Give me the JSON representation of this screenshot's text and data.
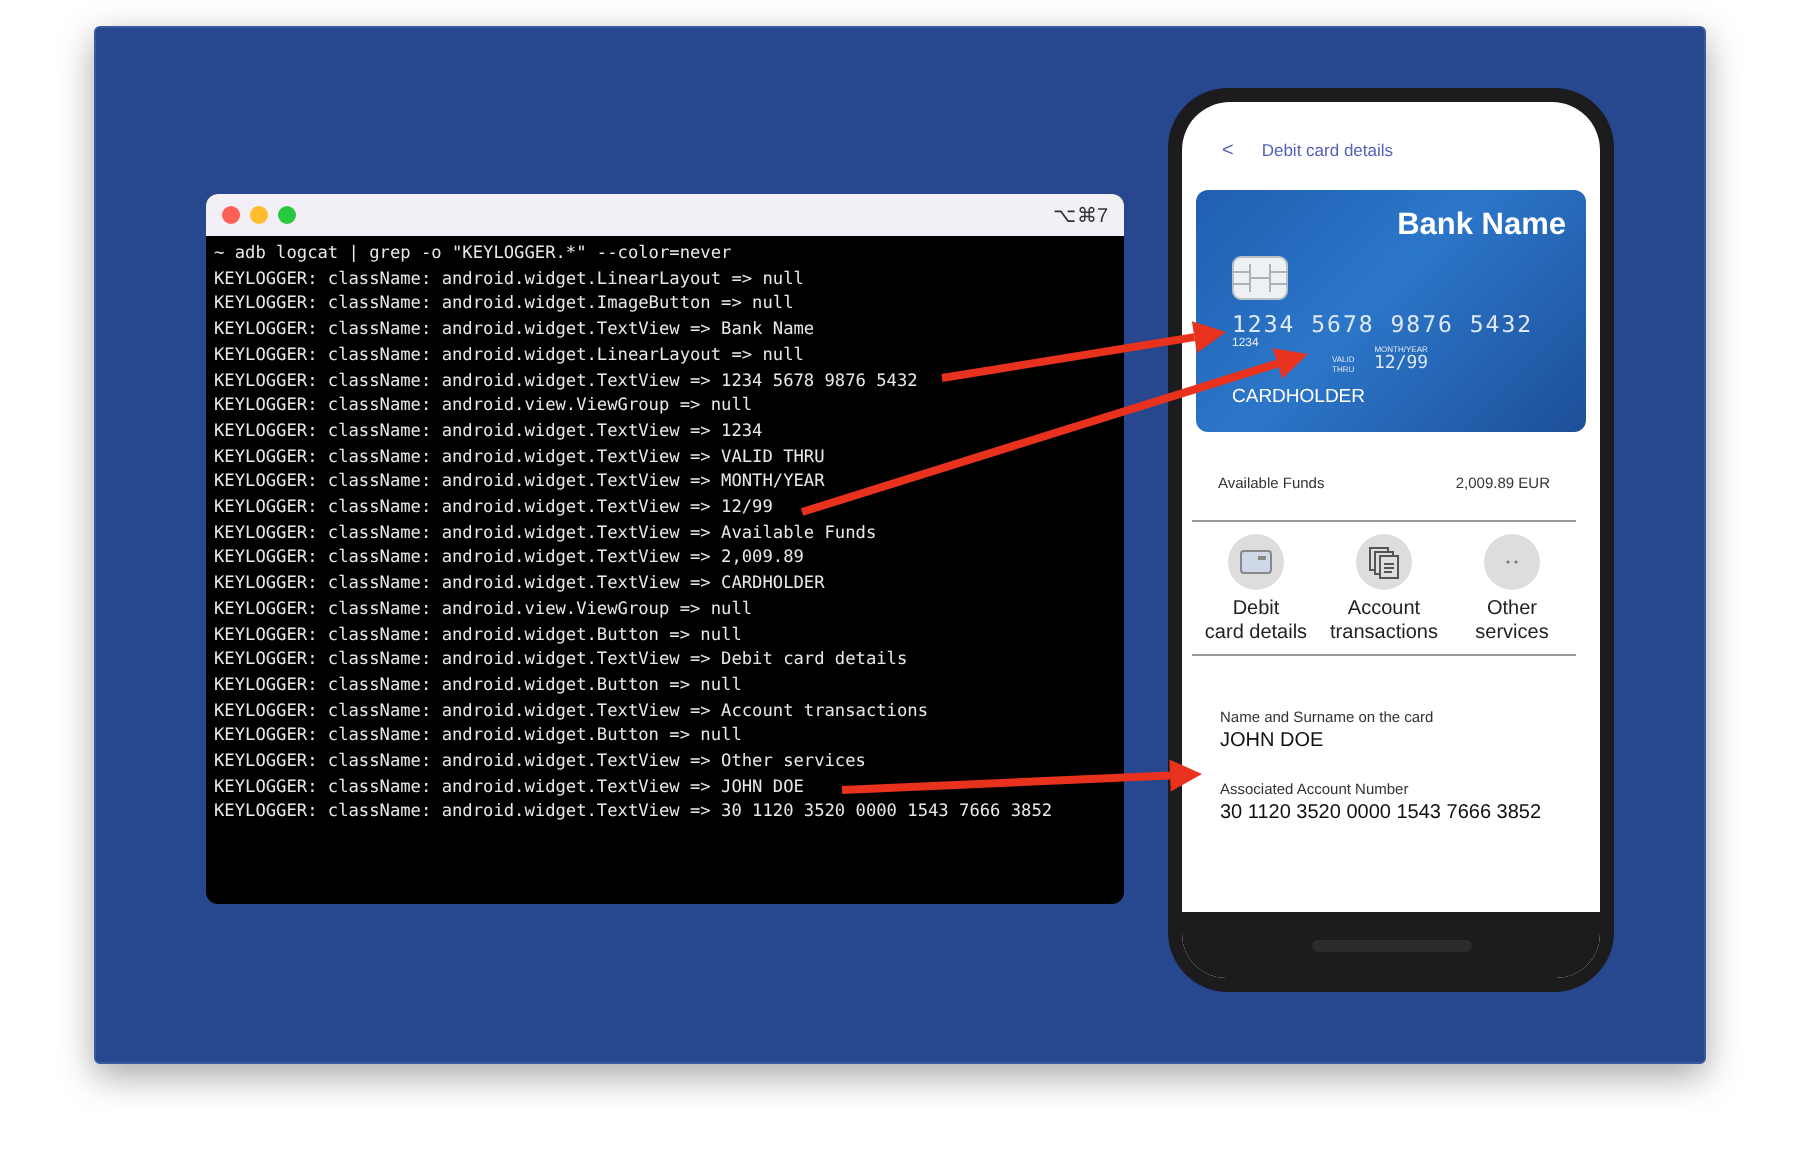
{
  "terminal": {
    "shortcut": "⌥⌘7",
    "lines": [
      "~ adb logcat | grep -o \"KEYLOGGER.*\" --color=never",
      "KEYLOGGER: className: android.widget.LinearLayout => null",
      "KEYLOGGER: className: android.widget.ImageButton => null",
      "KEYLOGGER: className: android.widget.TextView => Bank Name",
      "KEYLOGGER: className: android.widget.LinearLayout => null",
      "KEYLOGGER: className: android.widget.TextView => 1234 5678 9876 5432",
      "KEYLOGGER: className: android.view.ViewGroup => null",
      "KEYLOGGER: className: android.widget.TextView => 1234",
      "KEYLOGGER: className: android.widget.TextView => VALID THRU",
      "KEYLOGGER: className: android.widget.TextView => MONTH/YEAR",
      "KEYLOGGER: className: android.widget.TextView => 12/99",
      "KEYLOGGER: className: android.widget.TextView => Available Funds",
      "KEYLOGGER: className: android.widget.TextView => 2,009.89",
      "KEYLOGGER: className: android.widget.TextView => CARDHOLDER",
      "KEYLOGGER: className: android.view.ViewGroup => null",
      "KEYLOGGER: className: android.widget.Button => null",
      "KEYLOGGER: className: android.widget.TextView => Debit card details",
      "KEYLOGGER: className: android.widget.Button => null",
      "KEYLOGGER: className: android.widget.TextView => Account transactions",
      "KEYLOGGER: className: android.widget.Button => null",
      "KEYLOGGER: className: android.widget.TextView => Other services",
      "KEYLOGGER: className: android.widget.TextView => JOHN DOE",
      "KEYLOGGER: className: android.widget.TextView => 30 1120 3520 0000 1543 7666 3852"
    ]
  },
  "phone": {
    "back": "<",
    "title": "Debit card details",
    "card": {
      "bank_name": "Bank Name",
      "number": "1234 5678 9876 5432",
      "number_short": "1234",
      "valid_label": "VALID THRU",
      "expiry_label": "MONTH/YEAR",
      "expiry": "12/99",
      "holder": "CARDHOLDER"
    },
    "funds": {
      "label": "Available Funds",
      "value": "2,009.89 EUR"
    },
    "actions": [
      {
        "kind": "card",
        "lines": [
          "Debit",
          "card details"
        ]
      },
      {
        "kind": "documents",
        "lines": [
          "Account",
          "transactions"
        ]
      },
      {
        "kind": "more",
        "lines": [
          "Other",
          "services"
        ]
      }
    ],
    "fields": [
      {
        "label": "Name and Surname on the card",
        "value": "JOHN DOE"
      },
      {
        "label": "Associated Account Number",
        "value": "30 1120 3520 0000 1543 7666 3852"
      }
    ]
  }
}
